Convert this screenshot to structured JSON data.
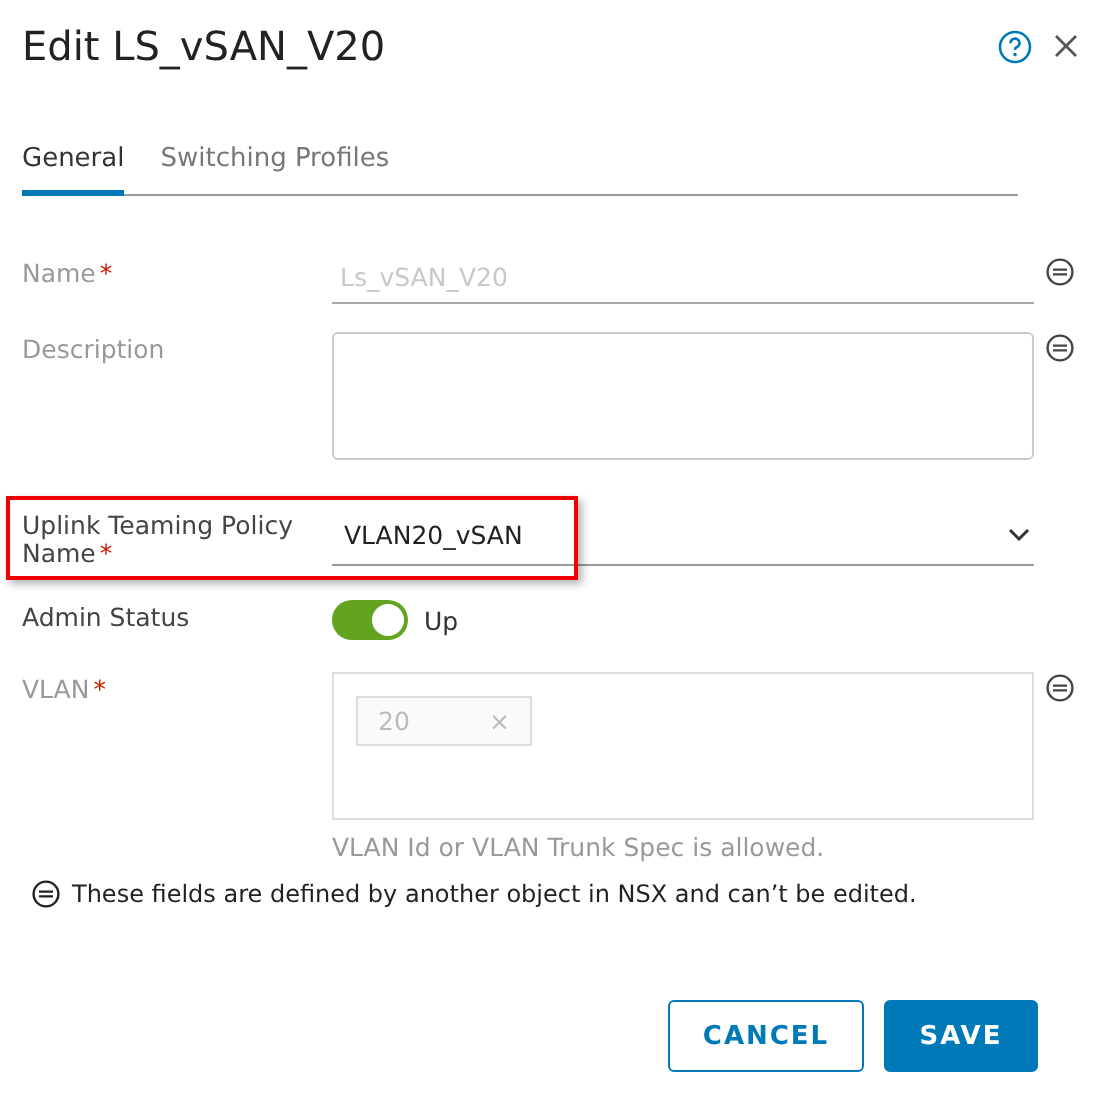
{
  "dialog": {
    "title": "Edit LS_vSAN_V20"
  },
  "tabs": [
    {
      "label": "General",
      "selected": true
    },
    {
      "label": "Switching Profiles",
      "selected": false
    }
  ],
  "fields": [
    {
      "kind": "text",
      "label": "Name",
      "required_mark": "*",
      "value": "Ls_vSAN_V20",
      "disabled": true,
      "locked": true
    },
    {
      "kind": "textarea",
      "label": "Description",
      "disabled": true,
      "locked": true
    },
    {
      "kind": "select",
      "label": "Uplink Teaming Policy Name",
      "required_mark": "*",
      "value": "VLAN20_vSAN",
      "highlighted": true
    },
    {
      "kind": "toggle",
      "label": "Admin Status",
      "on": true,
      "value": "Up"
    },
    {
      "kind": "tags",
      "label": "VLAN",
      "required_mark": "*",
      "tags": [
        {
          "text": "20",
          "remove": "×"
        }
      ],
      "hint": "VLAN Id or VLAN Trunk Spec is allowed.",
      "disabled": true,
      "locked": true
    }
  ],
  "note": "These fields are defined by another object in NSX and can’t be edited.",
  "buttons": [
    {
      "label": "CANCEL",
      "kind": "secondary"
    },
    {
      "label": "SAVE",
      "kind": "primary"
    }
  ]
}
